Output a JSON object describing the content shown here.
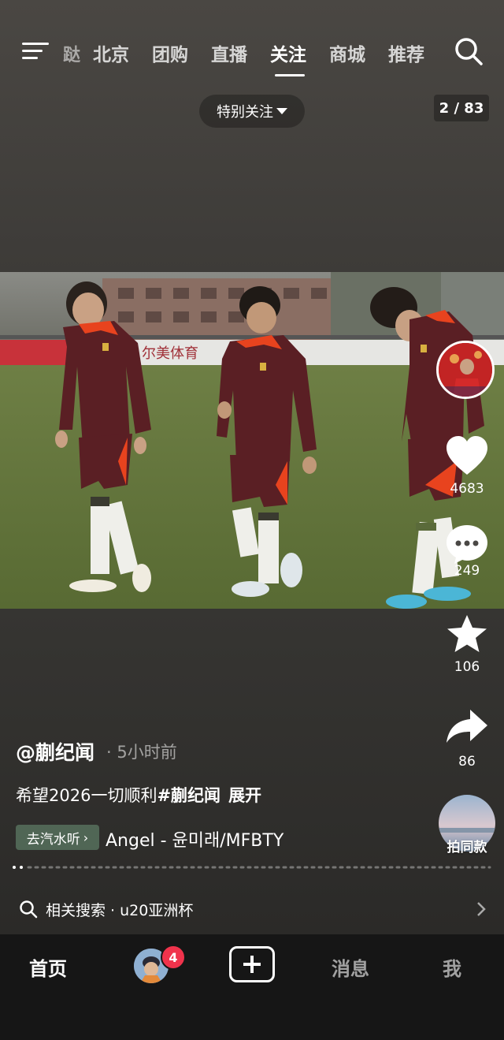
{
  "top_nav": {
    "partial_tab": "跶",
    "tabs": [
      {
        "label": "北京",
        "active": false
      },
      {
        "label": "团购",
        "active": false
      },
      {
        "label": "直播",
        "active": false
      },
      {
        "label": "关注",
        "active": true
      },
      {
        "label": "商城",
        "active": false
      },
      {
        "label": "推荐",
        "active": false
      }
    ],
    "icons": [
      "menu-icon",
      "search-icon"
    ]
  },
  "special_follow": "特别关注",
  "page_counter": "2 / 83",
  "photo": {
    "banner_text": "尔美体育"
  },
  "actions": {
    "likes": "4683",
    "comments": "249",
    "favorites": "106",
    "shares": "86",
    "same_style": "拍同款"
  },
  "post": {
    "author": "@蒯纪闻",
    "time": "· 5小时前",
    "caption": "希望2026一切顺利",
    "hashtag": "#蒯纪闻",
    "expand": "展开"
  },
  "music": {
    "badge": "去汽水听",
    "track": "Angel - 윤미래/MFBTY"
  },
  "related_search": {
    "label": "相关搜索",
    "query": "· u20亚洲杯"
  },
  "bottom_nav": {
    "home": "首页",
    "badge": "4",
    "messages": "消息",
    "me": "我"
  },
  "colors": {
    "badge_red": "#f0334c",
    "jersey": "#5a1f24",
    "accent_orange": "#e8431e"
  }
}
